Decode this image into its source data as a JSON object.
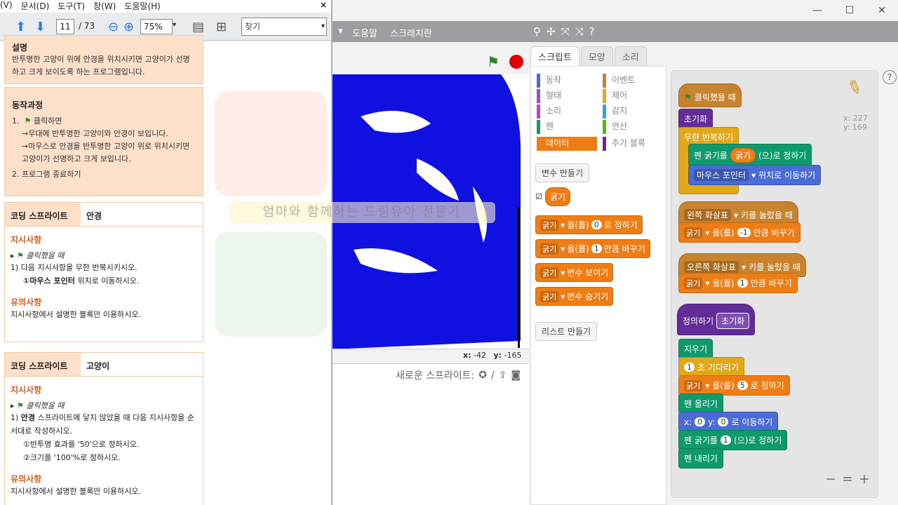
{
  "window_controls": {
    "minimize": "—",
    "maximize": "☐",
    "close": "✕"
  },
  "scratch": {
    "menu": [
      "도움말",
      "스크래치란"
    ],
    "menu_arrow": "▾",
    "tool_icons": [
      "stamp-icon",
      "cut-icon",
      "grow-icon",
      "shrink-icon",
      "help-icon"
    ],
    "stage_coords": {
      "x_label": "x:",
      "x": "-42",
      "y_label": "y:",
      "y": "-165"
    },
    "new_sprite_label": "새로운 스프라이트:",
    "tabs": [
      "스크립트",
      "모양",
      "소리"
    ],
    "categories_left": [
      "동작",
      "형태",
      "소리",
      "펜",
      "데이터"
    ],
    "categories_right": [
      "이벤트",
      "제어",
      "감지",
      "연산",
      "추가 블록"
    ],
    "category_colors": {
      "동작": "#4a6cd4",
      "형태": "#8a55d7",
      "소리": "#bb42c3",
      "펜": "#0e9a6c",
      "데이터": "#ee7d16",
      "이벤트": "#c88330",
      "제어": "#e1a91a",
      "감지": "#2ca5e2",
      "연산": "#5cb712",
      "추가 블록": "#632d99"
    },
    "make_variable": "변수 만들기",
    "variable_name": "굵기",
    "palette_blocks": [
      {
        "var": "굵기",
        "text": "을(를)",
        "num": "0",
        "tail": "로 정하기"
      },
      {
        "var": "굵기",
        "text": "을(를)",
        "num": "1",
        "tail": "만큼 바꾸기"
      },
      {
        "var": "굵기",
        "text": "변수 보이기"
      },
      {
        "var": "굵기",
        "text": "변수 숨기기"
      }
    ],
    "make_list": "리스트 만들기",
    "script": {
      "when_flag": "클릭했을 때",
      "init": "초기화",
      "forever": "무한 반복하기",
      "set_pen_size_pre": "펜 굵기를",
      "set_pen_size_var": "굵기",
      "set_pen_size_post": "(으)로 정하기",
      "goto_mouse_a": "마우스 포인터",
      "goto_mouse_b": "위치로 이동하기",
      "left_key": "왼쪽 화살표",
      "key_pressed": "키를 눌렀을 때",
      "var": "굵기",
      "change_by": "을(를)",
      "neg_one": "-1",
      "change_tail": "만큼 바꾸기",
      "right_key": "오른쪽 화살표",
      "one": "1",
      "define": "정의하기",
      "define_name": "초기화",
      "clear": "지우기",
      "wait_tail": "초 기다리기",
      "set_tail": "로 정하기",
      "five": "5",
      "pen_down": "펜 올리기",
      "goto_x": "x:",
      "zero": "0",
      "goto_y": "y:",
      "goto_tail": "로 이동하기",
      "pen_size_tail": "(으)로 정하기",
      "pen_up": "펜 내리기"
    },
    "sprite_x": "x: 227",
    "sprite_y": "y: 169",
    "zoom_controls": [
      "－",
      "＝",
      "＋"
    ]
  },
  "pdf": {
    "menu": [
      "(V)",
      "문서(D)",
      "도구(T)",
      "창(W)",
      "도움말(H)"
    ],
    "close": "×",
    "page_current": "11",
    "page_total": "/ 73",
    "zoom": "75%",
    "find_placeholder": "찾기",
    "intro_title": "설명",
    "intro_text": "반투명한 고양이 위에 안경을 위치시키면 고양이가 선명하고 크게 보이도록 하는 프로그램입니다.",
    "process_title": "동작과정",
    "process_1": "1.",
    "process_1_text": "클릭하면",
    "process_1a": "→무대에 반투명한 고양이와 안경이 보입니다.",
    "process_1b": "→마우스로 안경을 반투명한 고양이 위로 위치시키면 고양이가 선명하고 크게 보입니다.",
    "process_2": "2.  프로그램 종료하기",
    "card1": {
      "label": "코딩 스프라이트",
      "value": "안경",
      "instr_title": "지시사항",
      "flag_text": "클릭했을 때",
      "step1": "1) 다음 지시사항을 무한 반복시키시오.",
      "step1a_bold": "①마우스 포인터",
      "step1a_rest": " 위치로 이동하시오.",
      "caution_title": "유의사항",
      "caution": "지시사항에서 설명한 블록만 이용하시오."
    },
    "card2": {
      "label": "코딩 스프라이트",
      "value": "고양이",
      "instr_title": "지시사항",
      "flag_text": "클릭했을 때",
      "step1_a": "1) ",
      "step1_bold": "안경",
      "step1_b": " 스프라이트에 닿지 않았을 때 다음 지시사항을 순서대로 작성하시오.",
      "step1a": "①반투명 효과를 '50'으로 정하시오.",
      "step1b": "②크기를 '100'%로 정하시오.",
      "caution_title": "유의사항",
      "caution": "지시사항에서 설명한 블록만 이용하시오."
    },
    "watermark_text": "엄마와 함께하는 드림유아 전문가"
  }
}
